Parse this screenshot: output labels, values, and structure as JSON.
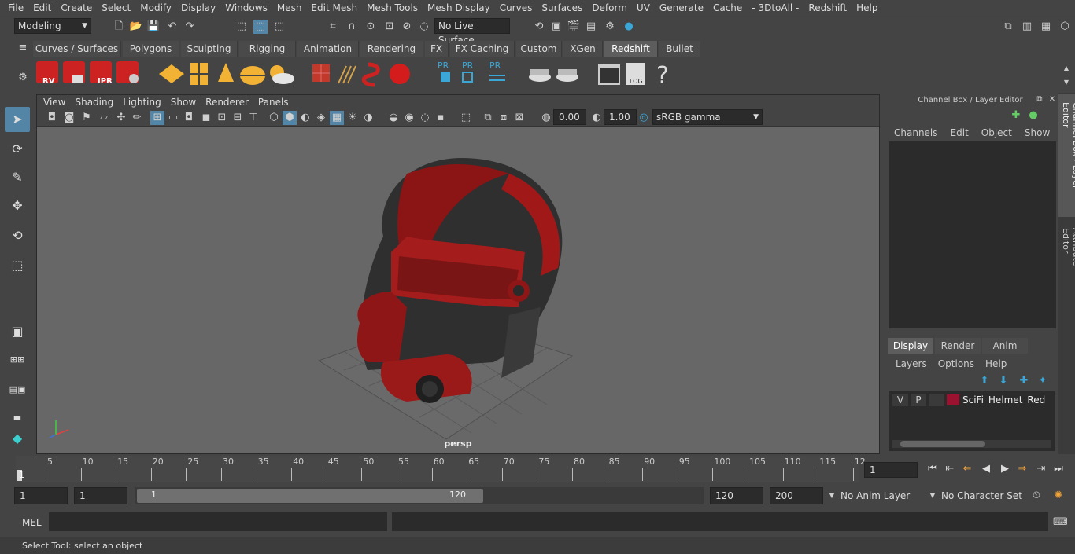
{
  "menubar": [
    "File",
    "Edit",
    "Create",
    "Select",
    "Modify",
    "Display",
    "Windows",
    "Mesh",
    "Edit Mesh",
    "Mesh Tools",
    "Mesh Display",
    "Curves",
    "Surfaces",
    "Deform",
    "UV",
    "Generate",
    "Cache",
    "- 3DtoAll -",
    "Redshift",
    "Help"
  ],
  "statusline": {
    "mode": "Modeling",
    "live_surface": "No Live Surface"
  },
  "shelf_tabs": [
    "Curves / Surfaces",
    "Polygons",
    "Sculpting",
    "Rigging",
    "Animation",
    "Rendering",
    "FX",
    "FX Caching",
    "Custom",
    "XGen",
    "Redshift",
    "Bullet"
  ],
  "active_shelf": "Redshift",
  "shelf_icon_labels": {
    "rv": "RV",
    "ipr": "IPR",
    "pr1": "PR",
    "pr2": "PR",
    "pr3": "PR",
    "log": "LOG",
    "help": "?"
  },
  "panel_menu": [
    "View",
    "Shading",
    "Lighting",
    "Show",
    "Renderer",
    "Panels"
  ],
  "panel_tools": {
    "exposure": "0.00",
    "gamma": "1.00",
    "color_space": "sRGB gamma"
  },
  "viewport": {
    "camera": "persp"
  },
  "channel_box": {
    "title": "Channel Box / Layer Editor",
    "menu": [
      "Channels",
      "Edit",
      "Object",
      "Show"
    ]
  },
  "layer_editor": {
    "tabs": [
      "Display",
      "Render",
      "Anim"
    ],
    "active_tab": "Display",
    "menu": [
      "Layers",
      "Options",
      "Help"
    ],
    "layers": [
      {
        "v": "V",
        "p": "P",
        "color": "#9b1230",
        "name": "SciFi_Helmet_Red"
      }
    ]
  },
  "side_tabs": [
    "Channel Box / Layer Editor",
    "Attribute Editor"
  ],
  "timeline": {
    "ticks": [
      "5",
      "10",
      "15",
      "20",
      "25",
      "30",
      "35",
      "40",
      "45",
      "50",
      "55",
      "60",
      "65",
      "70",
      "75",
      "80",
      "85",
      "90",
      "95",
      "100",
      "105",
      "110",
      "115",
      "12"
    ],
    "start_label": "1",
    "current_frame": "1"
  },
  "range": {
    "start": "1",
    "start2": "1",
    "slider_start": "1",
    "slider_end": "120",
    "end": "120",
    "max_end": "200",
    "anim_layer": "No Anim Layer",
    "char_set": "No Character Set"
  },
  "cmdline": {
    "label": "MEL"
  },
  "help_line": "Select Tool: select an object"
}
